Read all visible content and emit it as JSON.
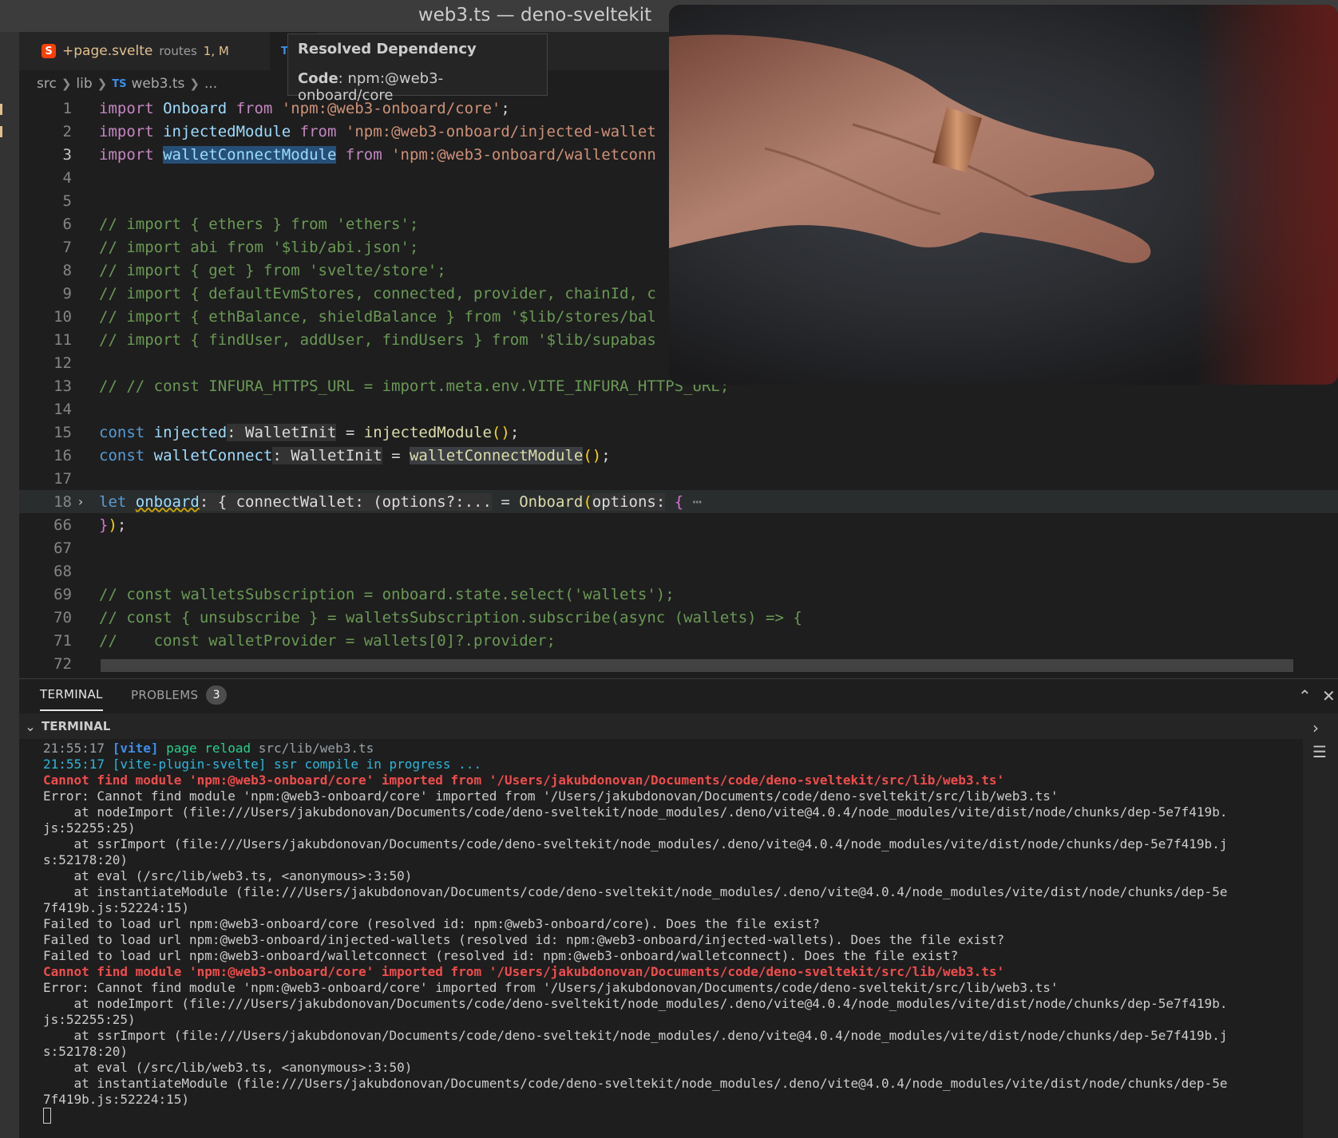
{
  "window": {
    "title": "web3.ts — deno-sveltekit"
  },
  "tabs": [
    {
      "name": "+page.svelte",
      "dir": "routes",
      "badge": "1, M",
      "icon": "svelte-icon"
    },
    {
      "name": "TS",
      "icon": "ts-icon"
    }
  ],
  "breadcrumb": {
    "parts": [
      "src",
      "lib",
      "TS",
      "web3.ts",
      "..."
    ]
  },
  "tooltip": {
    "title": "Resolved Dependency",
    "code_label": "Code",
    "code_value": ": npm:@web3-onboard/core"
  },
  "editor": {
    "lines": [
      {
        "n": "1",
        "t": [
          "import",
          " Onboard ",
          "from",
          " 'npm:@web3-onboard/core'",
          ";"
        ]
      },
      {
        "n": "2",
        "t": [
          "import",
          " injectedModule ",
          "from",
          " 'npm:@web3-onboard/injected-wallet"
        ]
      },
      {
        "n": "3",
        "t": [
          "import",
          " ",
          "walletConnectModule",
          " ",
          "from",
          " 'npm:@web3-onboard/walletconn"
        ]
      },
      {
        "n": "4",
        "t": []
      },
      {
        "n": "5",
        "t": []
      },
      {
        "n": "6",
        "t": [
          "// import { ethers } from 'ethers';"
        ]
      },
      {
        "n": "7",
        "t": [
          "// import abi from '$lib/abi.json';"
        ]
      },
      {
        "n": "8",
        "t": [
          "// import { get } from 'svelte/store';"
        ]
      },
      {
        "n": "9",
        "t": [
          "// import { defaultEvmStores, connected, provider, chainId, c"
        ]
      },
      {
        "n": "10",
        "t": [
          "// import { ethBalance, shieldBalance } from '$lib/stores/bal"
        ]
      },
      {
        "n": "11",
        "t": [
          "// import { findUser, addUser, findUsers } from '$lib/supabas"
        ]
      },
      {
        "n": "12",
        "t": []
      },
      {
        "n": "13",
        "t": [
          "// // const INFURA_HTTPS_URL = import.meta.env.VITE_INFURA_HTTPS_URL;"
        ]
      },
      {
        "n": "14",
        "t": []
      },
      {
        "n": "15",
        "t": [
          "const",
          " injected",
          ": WalletInit",
          " = ",
          "injectedModule",
          "(",
          ")",
          ";"
        ]
      },
      {
        "n": "16",
        "t": [
          "const",
          " walletConnect",
          ": WalletInit",
          " = ",
          "walletConnectModule",
          "(",
          ")",
          ";"
        ]
      },
      {
        "n": "17",
        "t": []
      },
      {
        "n": "18",
        "t": [
          "let",
          " ",
          "onboard",
          ": { connectWallet: (options?:...",
          " = ",
          "Onboard",
          "(",
          "options:",
          " ",
          "{",
          " ⋯"
        ]
      },
      {
        "n": "66",
        "t": [
          "}",
          ")",
          ";"
        ]
      },
      {
        "n": "67",
        "t": []
      },
      {
        "n": "68",
        "t": []
      },
      {
        "n": "69",
        "t": [
          "// const walletsSubscription = onboard.state.select('wallets');"
        ]
      },
      {
        "n": "70",
        "t": [
          "// const { unsubscribe } = walletsSubscription.subscribe(async (wallets) => {"
        ]
      },
      {
        "n": "71",
        "t": [
          "//    const walletProvider = wallets[0]?.provider;"
        ]
      },
      {
        "n": "72",
        "t": []
      }
    ]
  },
  "panel": {
    "tabs": [
      {
        "label": "TERMINAL"
      },
      {
        "label": "PROBLEMS",
        "count": "3"
      }
    ],
    "terminal_header": "TERMINAL"
  },
  "terminal": {
    "l1": {
      "time": "21:55:17 ",
      "tag": "[vite]",
      "msg": " page reload ",
      "path": "src/lib/web3.ts"
    },
    "l2": "21:55:17 [vite-plugin-svelte] ssr compile in progress ...",
    "lines": [
      {
        "k": "err",
        "t": "Cannot find module 'npm:@web3-onboard/core' imported from '/Users/jakubdonovan/Documents/code/deno-sveltekit/src/lib/web3.ts'"
      },
      {
        "k": "n",
        "t": "Error: Cannot find module 'npm:@web3-onboard/core' imported from '/Users/jakubdonovan/Documents/code/deno-sveltekit/src/lib/web3.ts'"
      },
      {
        "k": "n",
        "t": "    at nodeImport (file:///Users/jakubdonovan/Documents/code/deno-sveltekit/node_modules/.deno/vite@4.0.4/node_modules/vite/dist/node/chunks/dep-5e7f419b."
      },
      {
        "k": "n",
        "t": "js:52255:25)"
      },
      {
        "k": "n",
        "t": "    at ssrImport (file:///Users/jakubdonovan/Documents/code/deno-sveltekit/node_modules/.deno/vite@4.0.4/node_modules/vite/dist/node/chunks/dep-5e7f419b.j"
      },
      {
        "k": "n",
        "t": "s:52178:20)"
      },
      {
        "k": "n",
        "t": "    at eval (/src/lib/web3.ts, <anonymous>:3:50)"
      },
      {
        "k": "n",
        "t": "    at instantiateModule (file:///Users/jakubdonovan/Documents/code/deno-sveltekit/node_modules/.deno/vite@4.0.4/node_modules/vite/dist/node/chunks/dep-5e"
      },
      {
        "k": "n",
        "t": "7f419b.js:52224:15)"
      },
      {
        "k": "n",
        "t": "Failed to load url npm:@web3-onboard/core (resolved id: npm:@web3-onboard/core). Does the file exist?"
      },
      {
        "k": "n",
        "t": "Failed to load url npm:@web3-onboard/injected-wallets (resolved id: npm:@web3-onboard/injected-wallets). Does the file exist?"
      },
      {
        "k": "n",
        "t": "Failed to load url npm:@web3-onboard/walletconnect (resolved id: npm:@web3-onboard/walletconnect). Does the file exist?"
      },
      {
        "k": "err",
        "t": "Cannot find module 'npm:@web3-onboard/core' imported from '/Users/jakubdonovan/Documents/code/deno-sveltekit/src/lib/web3.ts'"
      },
      {
        "k": "n",
        "t": "Error: Cannot find module 'npm:@web3-onboard/core' imported from '/Users/jakubdonovan/Documents/code/deno-sveltekit/src/lib/web3.ts'"
      },
      {
        "k": "n",
        "t": "    at nodeImport (file:///Users/jakubdonovan/Documents/code/deno-sveltekit/node_modules/.deno/vite@4.0.4/node_modules/vite/dist/node/chunks/dep-5e7f419b."
      },
      {
        "k": "n",
        "t": "js:52255:25)"
      },
      {
        "k": "n",
        "t": "    at ssrImport (file:///Users/jakubdonovan/Documents/code/deno-sveltekit/node_modules/.deno/vite@4.0.4/node_modules/vite/dist/node/chunks/dep-5e7f419b.j"
      },
      {
        "k": "n",
        "t": "s:52178:20)"
      },
      {
        "k": "n",
        "t": "    at eval (/src/lib/web3.ts, <anonymous>:3:50)"
      },
      {
        "k": "n",
        "t": "    at instantiateModule (file:///Users/jakubdonovan/Documents/code/deno-sveltekit/node_modules/.deno/vite@4.0.4/node_modules/vite/dist/node/chunks/dep-5e"
      },
      {
        "k": "n",
        "t": "7f419b.js:52224:15)"
      }
    ]
  }
}
